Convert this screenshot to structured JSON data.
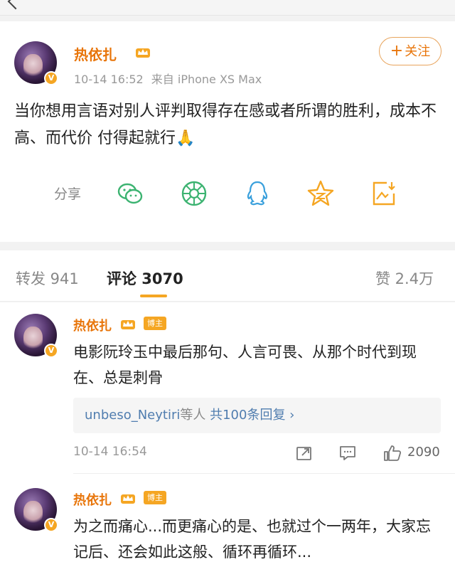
{
  "post": {
    "username": "热依扎",
    "time": "10-14 16:52",
    "source": "来自 iPhone XS Max",
    "follow_label": "关注",
    "follow_plus": "+",
    "text": "当你想用言语对别人评判取得存在感或者所谓的胜利，成本不高、而代价 付得起就行",
    "text_emoji": "🙏",
    "share_label": "分享",
    "share_icons": [
      "wechat-icon",
      "moments-icon",
      "qq-icon",
      "qzone-icon",
      "save-image-icon"
    ]
  },
  "tabs": {
    "repost": "转发 941",
    "comments": "评论 3070",
    "likes": "赞 2.4万"
  },
  "colors": {
    "accent": "#f5a623",
    "username": "#e8750a",
    "icon_green": "#3cb371",
    "link_blue": "#507daf"
  },
  "comments": [
    {
      "username": "热依扎",
      "badge": "博主",
      "text": "电影阮玲玉中最后那句、人言可畏、从那个时代到现在、总是刺骨",
      "reply_who": "unbeso_Neytiri",
      "reply_etc": "等人",
      "reply_count": "共100条回复 ›",
      "time": "10-14 16:54",
      "likes": "2090"
    },
    {
      "username": "热依扎",
      "badge": "博主",
      "text": "为之而痛心...而更痛心的是、也就过个一两年，大家忘记后、还会如此这般、循环再循环..."
    }
  ]
}
